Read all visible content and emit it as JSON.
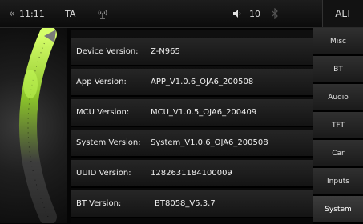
{
  "status_bar": {
    "back_icon": "back-chevrons-icon",
    "time": "11:11",
    "ta_label": "TA",
    "antenna_icon": "antenna-icon",
    "volume_icon": "speaker-icon",
    "volume_value": "10",
    "bluetooth_icon": "bluetooth-icon",
    "alt_label": "ALT"
  },
  "info_rows": [
    {
      "label": "Device Version:",
      "value": "Z-N965"
    },
    {
      "label": "App Version:",
      "value": "APP_V1.0.6_OJA6_200508"
    },
    {
      "label": "MCU Version:",
      "value": "MCU_V1.0.5_OJA6_200409"
    },
    {
      "label": "System Version:",
      "value": "System_V1.0.6_OJA6_200508"
    },
    {
      "label": "UUID Version:",
      "value": "1282631184100009"
    },
    {
      "label": "BT Version:",
      "value": "BT8058_V5.3.7"
    }
  ],
  "tabs": [
    {
      "label": "Misc",
      "active": false
    },
    {
      "label": "BT",
      "active": false
    },
    {
      "label": "Audio",
      "active": false
    },
    {
      "label": "TFT",
      "active": false
    },
    {
      "label": "Car",
      "active": false
    },
    {
      "label": "Inputs",
      "active": false
    },
    {
      "label": "System",
      "active": true
    }
  ],
  "colors": {
    "background": "#050505",
    "dial_accent": "#9bd12a",
    "text": "#e8e8e8"
  }
}
